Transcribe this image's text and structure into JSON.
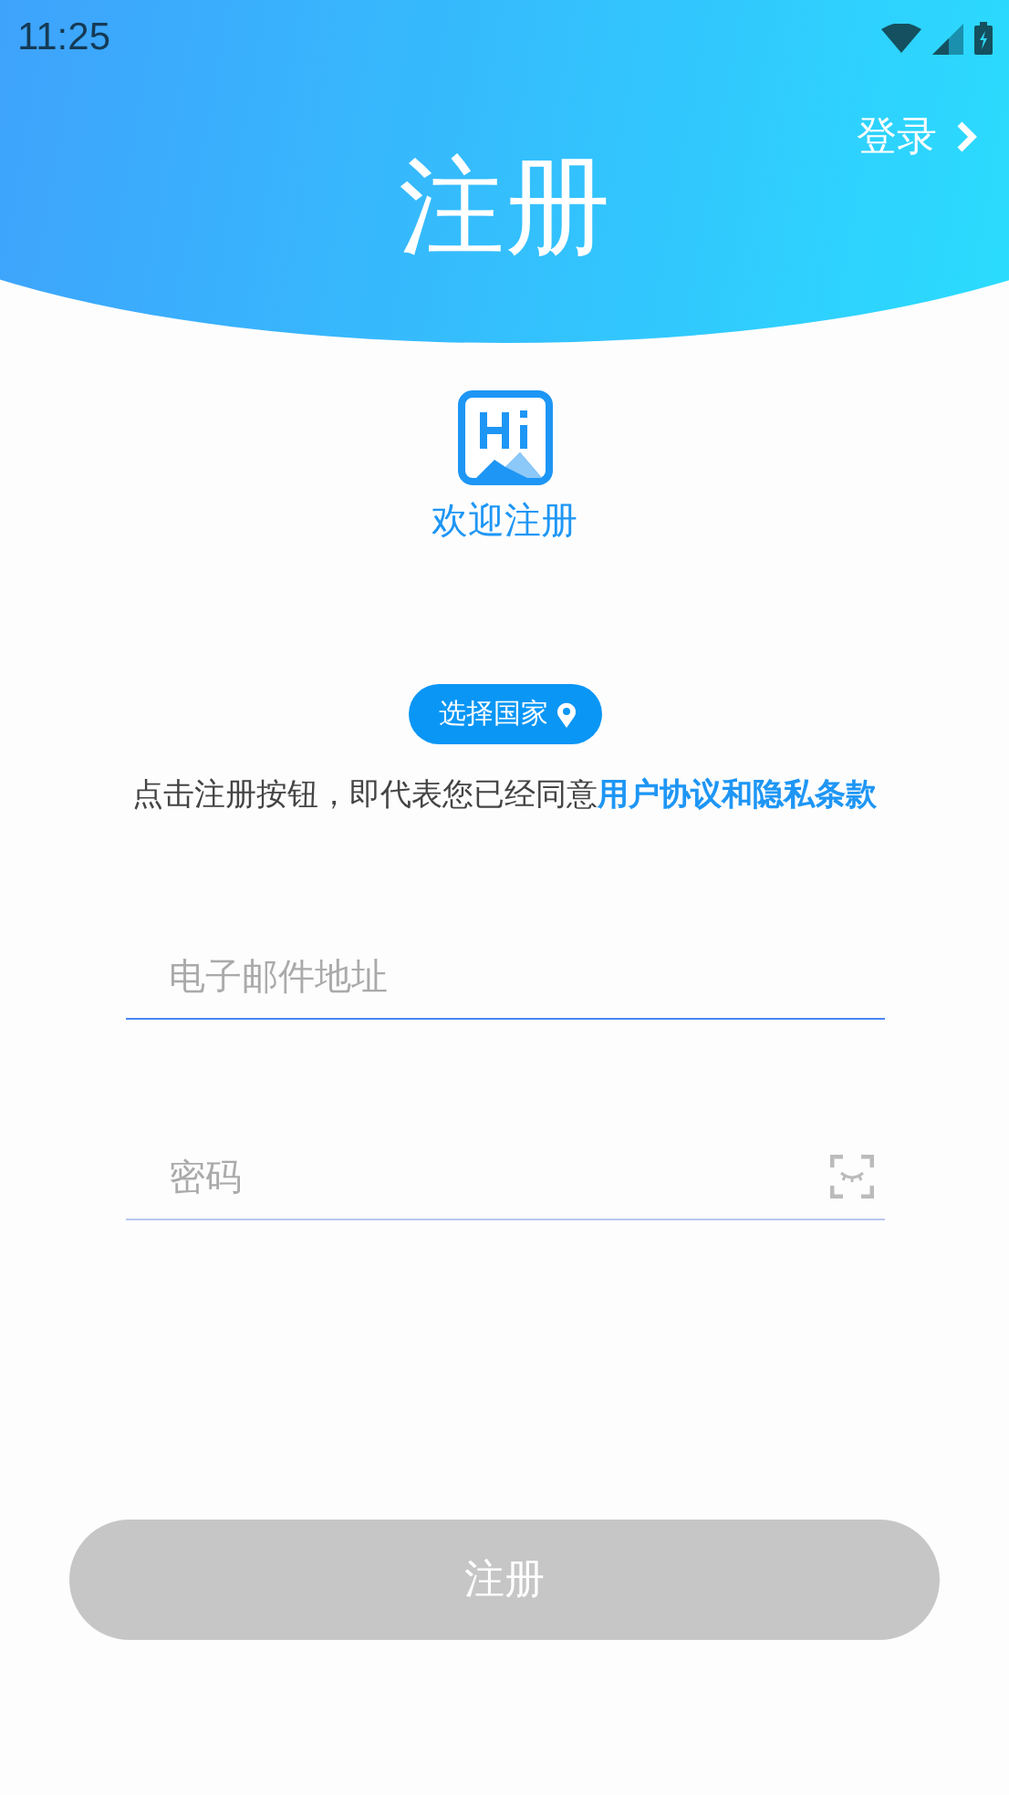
{
  "status_bar": {
    "time": "11:25"
  },
  "header": {
    "login_link": "登录",
    "title": "注册"
  },
  "logo": {
    "caption": "欢迎注册"
  },
  "country_button": {
    "label": "选择国家"
  },
  "agreement": {
    "text": "点击注册按钮，即代表您已经同意",
    "link": "用户协议和隐私条款"
  },
  "fields": [
    {
      "kind": "email",
      "placeholder": "电子邮件地址",
      "focused": true
    },
    {
      "kind": "password",
      "placeholder": "密码",
      "focused": false
    }
  ],
  "submit": {
    "label": "注册",
    "disabled": true
  }
}
